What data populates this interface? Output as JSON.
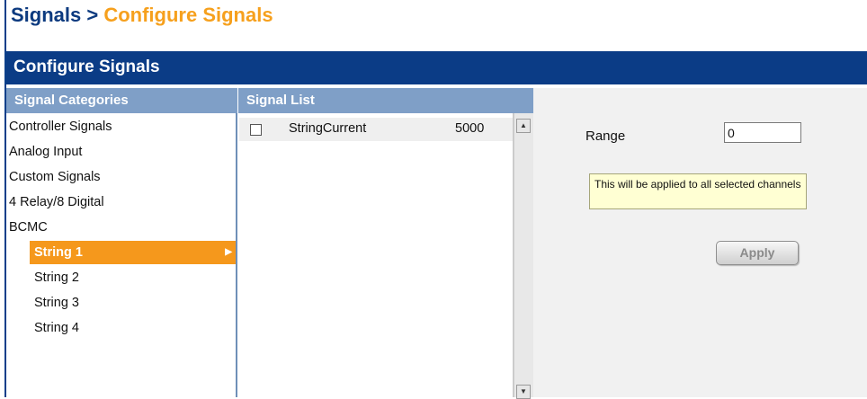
{
  "breadcrumb": {
    "root": "Signals",
    "separator": " > ",
    "current": "Configure Signals"
  },
  "title_bar": {
    "label": "Configure Signals"
  },
  "categories": {
    "header": "Signal Categories",
    "items": [
      {
        "label": "Controller Signals"
      },
      {
        "label": "Analog Input"
      },
      {
        "label": "Custom Signals"
      },
      {
        "label": "4 Relay/8 Digital"
      },
      {
        "label": "BCMC"
      }
    ],
    "subitems": [
      {
        "label": "String 1",
        "selected": true
      },
      {
        "label": "String 2"
      },
      {
        "label": "String 3"
      },
      {
        "label": "String 4"
      }
    ]
  },
  "signal_list": {
    "header": "Signal List",
    "rows": [
      {
        "name": "StringCurrent",
        "value": "5000",
        "checked": false
      }
    ]
  },
  "config": {
    "range_label": "Range",
    "range_value": "0",
    "tooltip": "This will be applied to all selected channels",
    "apply_label": "Apply"
  },
  "icons": {
    "scroll_up": "scroll-up-arrow",
    "scroll_down": "scroll-down-arrow",
    "submenu": "submenu-arrow"
  },
  "colors": {
    "title_bar": "#0b3c86",
    "header": "#7f9fc7",
    "accent": "#f5981c",
    "breadcrumb_current": "#f6a01d"
  }
}
